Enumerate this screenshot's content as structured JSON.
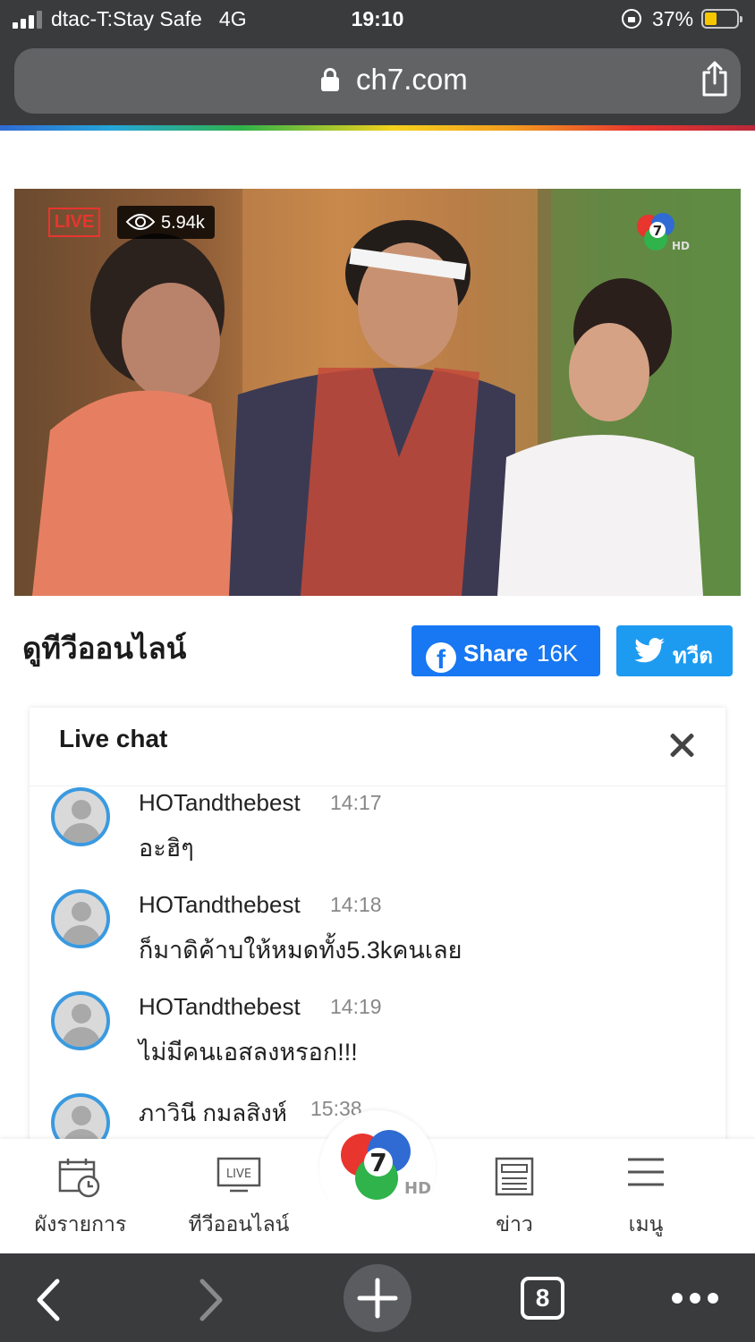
{
  "status_bar": {
    "carrier": "dtac-T:Stay Safe",
    "network": "4G",
    "time": "19:10",
    "battery": "37%"
  },
  "browser": {
    "url": "ch7.com"
  },
  "video": {
    "live_label": "LIVE",
    "viewers": "5.94k",
    "channel_logo": "ch7-hd-logo"
  },
  "page": {
    "title": "ดูทีวีออนไลน์"
  },
  "share": {
    "facebook_label": "Share",
    "facebook_count": "16K",
    "twitter_label": "ทวีต"
  },
  "chat": {
    "title": "Live chat",
    "messages": [
      {
        "user": "HOTandthebest",
        "time": "14:17",
        "text": "อะฮิๆ"
      },
      {
        "user": "HOTandthebest",
        "time": "14:18",
        "text": "ก็มาดิค้าบให้หมดทั้ง5.3kคนเลย"
      },
      {
        "user": "HOTandthebest",
        "time": "14:19",
        "text": "ไม่มีคนเอสลงหรอก!!!"
      },
      {
        "user": "ภาวินี กมลสิงห์",
        "time": "15:38",
        "text": ""
      }
    ]
  },
  "site_nav": {
    "items": [
      {
        "label": "ผังรายการ",
        "icon": "schedule-icon"
      },
      {
        "label": "ทีวีออนไลน์",
        "icon": "live-tv-icon"
      },
      {
        "label": "ข่าว",
        "icon": "news-icon"
      },
      {
        "label": "เมนู",
        "icon": "menu-icon"
      }
    ],
    "live_icon_text": "LIVE"
  },
  "toolbar": {
    "tabs_count": "8"
  },
  "colors": {
    "accent_blue": "#3a9ae0",
    "facebook": "#1877f2",
    "twitter": "#1d9bf0",
    "live_red": "#e8352e",
    "chrome_dark": "#3a3b3d"
  }
}
